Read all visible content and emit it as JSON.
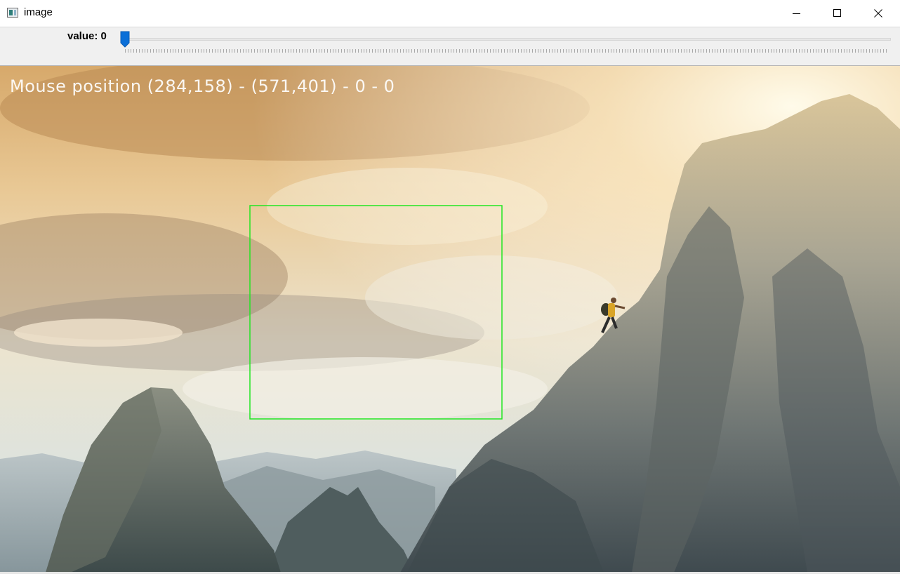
{
  "window": {
    "title": "image",
    "icon": "opencv-window-icon",
    "controls": [
      "minimize-icon",
      "maximize-icon",
      "close-icon"
    ]
  },
  "trackbar": {
    "label": "value: 0",
    "value": 0
  },
  "image": {
    "overlay_text": "Mouse position (284,158) - (571,401) - 0 - 0",
    "overlay_color": "#ffffff",
    "selection_color": "#22e622",
    "scene": "sunlit sky with clouds, climber on rocky mountain peak"
  },
  "colors": {
    "thumb": "#0a6fd8",
    "titlebar": "#ffffff",
    "panel": "#f0f0f0"
  }
}
